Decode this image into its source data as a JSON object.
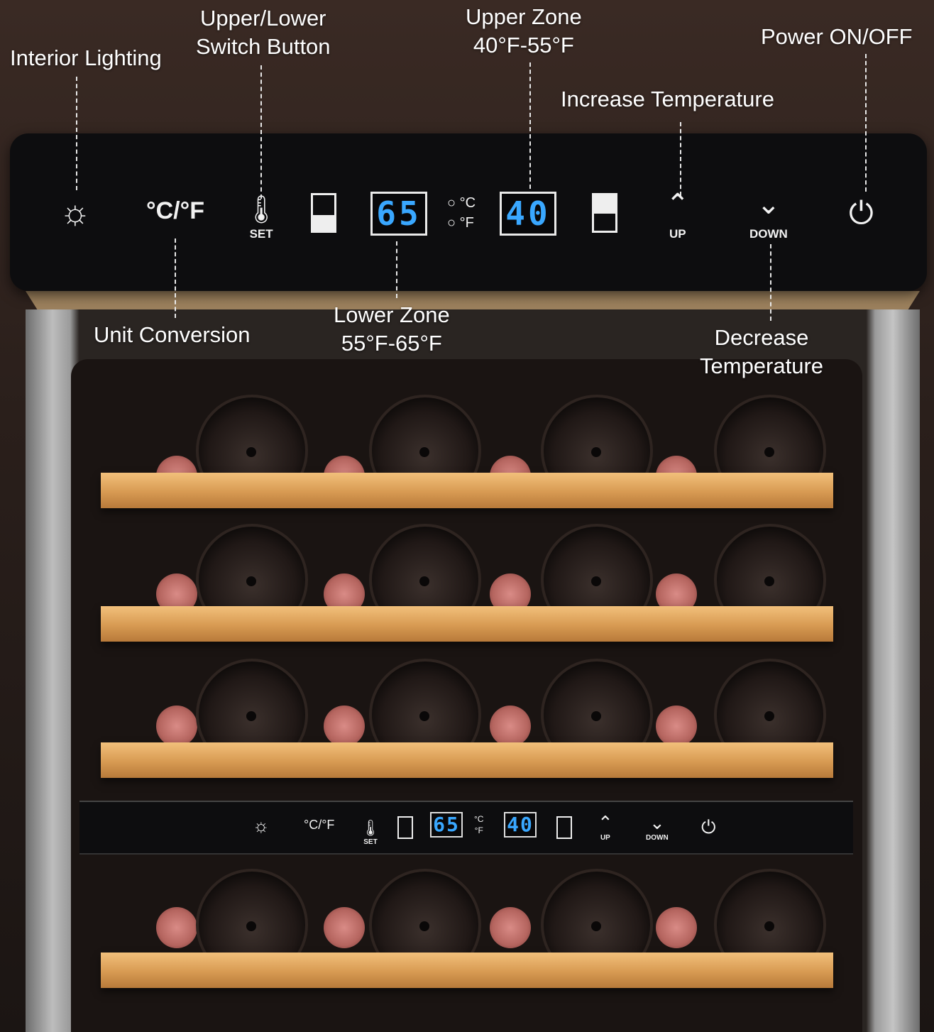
{
  "callouts": {
    "interior_lighting": "Interior Lighting",
    "switch_button": [
      "Upper/Lower",
      "Switch Button"
    ],
    "upper_zone": [
      "Upper Zone",
      "40°F-55°F"
    ],
    "power": "Power ON/OFF",
    "increase": "Increase Temperature",
    "unit_conversion": "Unit Conversion",
    "lower_zone": [
      "Lower Zone",
      "55°F-65°F"
    ],
    "decrease": [
      "Decrease",
      "Temperature"
    ]
  },
  "panel": {
    "light_icon": "☼",
    "unit_icon": "°C/°F",
    "set_label": "SET",
    "lower_display": "65",
    "celsius": "°C",
    "fahrenheit": "°F",
    "upper_display": "40",
    "up_label": "UP",
    "down_label": "DOWN",
    "up_glyph": "⌃",
    "down_glyph": "⌄",
    "power_glyph": "⏻"
  },
  "colors": {
    "display_digits": "#39a7ff",
    "panel": "#0d0d0f",
    "shelf": "#d79a52",
    "cork": "#b5655f"
  }
}
